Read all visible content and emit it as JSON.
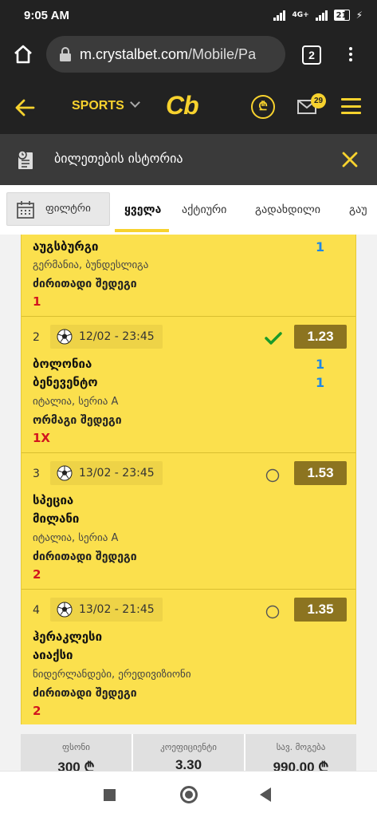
{
  "status_bar": {
    "time": "9:05 AM",
    "battery": "21",
    "network": "4G+"
  },
  "browser": {
    "url_domain": "m.crystalbet.com",
    "url_path": "/Mobile/Pa",
    "tabs_count": "2"
  },
  "header": {
    "sports_label": "SPORTS",
    "logo_text": "Cb",
    "coin_symbol": "₾",
    "mail_badge": "29"
  },
  "section": {
    "title": "ბილეთების ისტორია"
  },
  "filter": {
    "button_label": "ფილტრი",
    "tabs": [
      {
        "label": "ყველა",
        "active": true
      },
      {
        "label": "აქტიური",
        "active": false
      },
      {
        "label": "გადახდილი",
        "active": false
      },
      {
        "label": "გაუ",
        "active": false
      }
    ]
  },
  "events": [
    {
      "number": "",
      "date": "",
      "teams": [
        "აუგსბურგი"
      ],
      "league": "გერმანია, ბუნდესლიგა",
      "market": "ძირითადი შედეგი",
      "pick": "1",
      "scores": [
        "1"
      ],
      "odd": "",
      "status": "none"
    },
    {
      "number": "2",
      "date": "12/02 - 23:45",
      "teams": [
        "ბოლონია",
        "ბენევენტო"
      ],
      "league": "იტალია, სერია A",
      "market": "ორმაგი შედეგი",
      "pick": "1X",
      "scores": [
        "1",
        "1"
      ],
      "odd": "1.23",
      "status": "won"
    },
    {
      "number": "3",
      "date": "13/02 - 23:45",
      "teams": [
        "სპეცია",
        "მილანი"
      ],
      "league": "იტალია, სერია A",
      "market": "ძირითადი შედეგი",
      "pick": "2",
      "scores": [],
      "odd": "1.53",
      "status": "pending"
    },
    {
      "number": "4",
      "date": "13/02 - 21:45",
      "teams": [
        "ჰერაკლესი",
        "აიაქსი"
      ],
      "league": "ნიდერლანდები, ერედივიზიონი",
      "market": "ძირითადი შედეგი",
      "pick": "2",
      "scores": [],
      "odd": "1.35",
      "status": "pending"
    }
  ],
  "summary": {
    "stake_label": "ფსონი",
    "stake_value": "300 ₾",
    "coef_label": "კოეფიციენტი",
    "coef_value": "3.30",
    "win_label": "სავ. მოგება",
    "win_value": "990.00 ₾"
  },
  "colors": {
    "accent": "#f7d22e",
    "card": "#fbe04d",
    "odd_bg": "#8c7420",
    "pick_red": "#d2161e",
    "score_blue": "#1e88e5",
    "won_green": "#1a9a2a"
  }
}
